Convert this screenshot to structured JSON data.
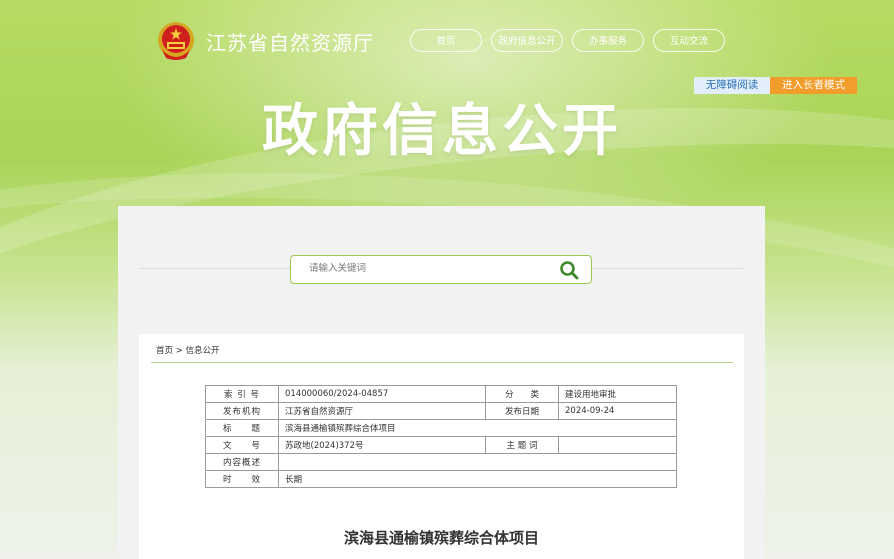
{
  "header": {
    "site_title": "江苏省自然资源厅",
    "nav": [
      "首页",
      "政府信息公开",
      "办事服务",
      "互动交流"
    ],
    "accessibility_label": "无障碍阅读",
    "elderly_mode_label": "进入长者模式",
    "banner_title": "政府信息公开"
  },
  "search": {
    "placeholder": "请输入关键词"
  },
  "breadcrumb": {
    "home": "首页",
    "sep": ">",
    "current": "信息公开"
  },
  "meta": {
    "index_no_label": "索 引 号",
    "index_no": "014000060/2024-04857",
    "category_label": "分　　类",
    "category": "建设用地审批",
    "publisher_label": "发布机构",
    "publisher": "江苏省自然资源厅",
    "date_label": "发布日期",
    "date": "2024-09-24",
    "title_label": "标　　题",
    "title": "滨海县通榆镇殡葬综合体项目",
    "doc_no_label": "文　　号",
    "doc_no": "苏政地(2024)372号",
    "subject_label": "主 题 词",
    "subject": "",
    "summary_label": "内容概述",
    "summary": "",
    "validity_label": "时　　效",
    "validity": "长期"
  },
  "doc_title": "滨海县通榆镇殡葬综合体项目",
  "colors": {
    "accent_green": "#9cc84f",
    "orange": "#f29d2b"
  }
}
